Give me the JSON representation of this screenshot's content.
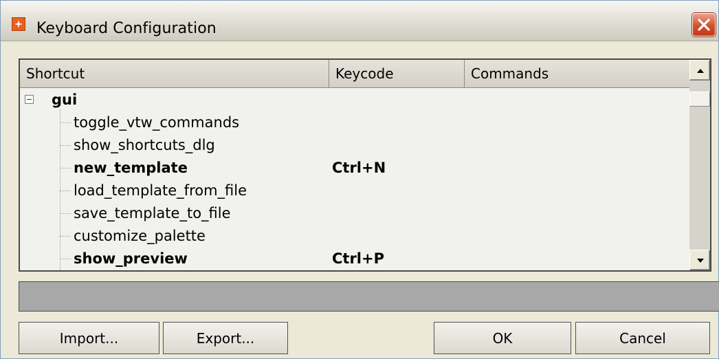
{
  "window": {
    "title": "Keyboard Configuration",
    "close_icon": "close-icon",
    "app_icon": "app-icon"
  },
  "tree": {
    "columns": [
      "Shortcut",
      "Keycode",
      "Commands"
    ],
    "group": {
      "name": "gui",
      "expanded": true,
      "toggle_symbol": "−"
    },
    "items": [
      {
        "name": "toggle_vtw_commands",
        "keycode": "",
        "bold": false
      },
      {
        "name": "show_shortcuts_dlg",
        "keycode": "",
        "bold": false
      },
      {
        "name": "new_template",
        "keycode": "Ctrl+N",
        "bold": true
      },
      {
        "name": "load_template_from_file",
        "keycode": "",
        "bold": false
      },
      {
        "name": "save_template_to_file",
        "keycode": "",
        "bold": false
      },
      {
        "name": "customize_palette",
        "keycode": "",
        "bold": false
      },
      {
        "name": "show_preview",
        "keycode": "Ctrl+P",
        "bold": true
      }
    ]
  },
  "description": {
    "value": ""
  },
  "buttons": {
    "import": "Import...",
    "export": "Export...",
    "ok": "OK",
    "cancel": "Cancel"
  },
  "colors": {
    "window_bg": "#ece9d8",
    "close_red": "#d2502c",
    "app_icon_orange": "#e8601d",
    "description_bg": "#a8a8a8"
  }
}
